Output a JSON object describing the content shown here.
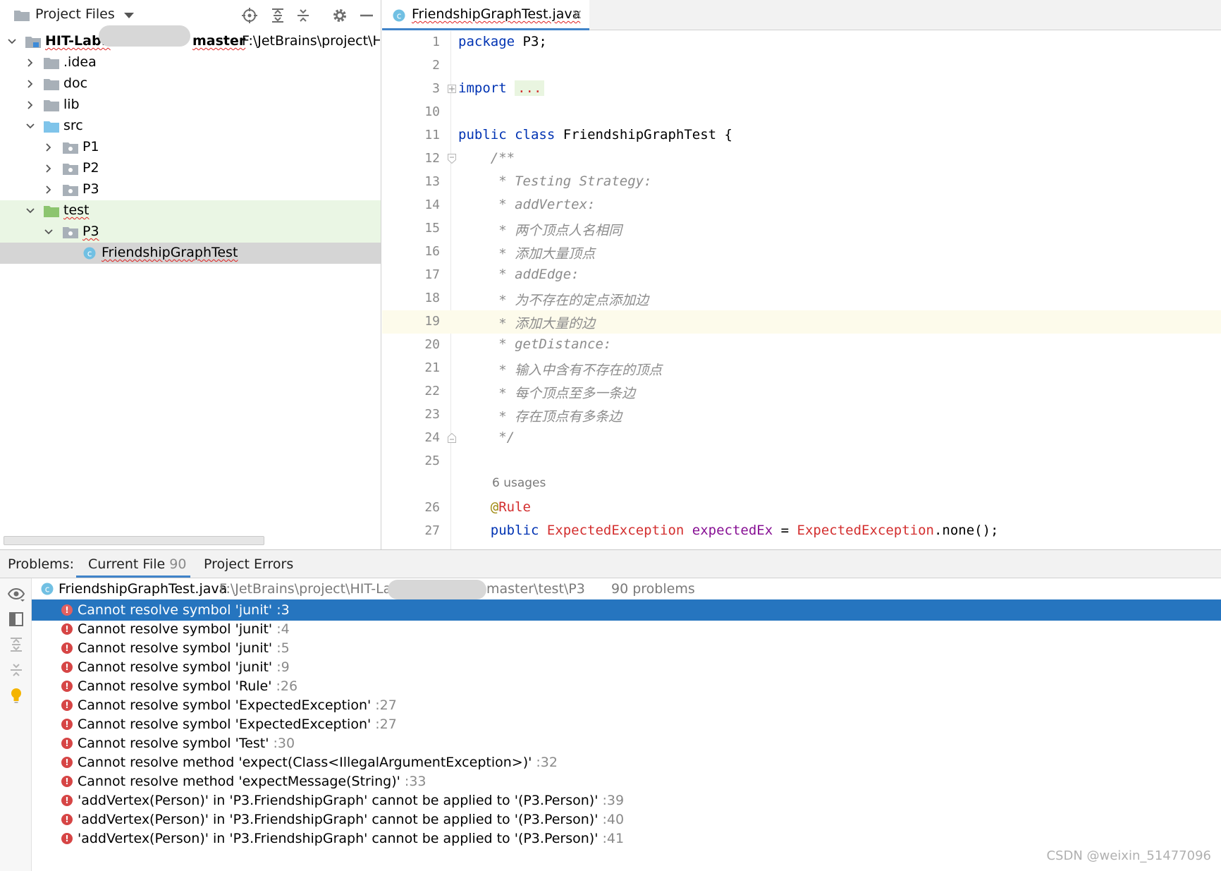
{
  "project_panel": {
    "title": "Project Files",
    "root": {
      "name_left": "HIT-Lab1",
      "name_right": "master",
      "path": "F:\\JetBrains\\project\\HIT"
    },
    "items": [
      {
        "label": "idea_placeholder"
      }
    ],
    "tree": {
      "idea": ".idea",
      "doc": "doc",
      "lib": "lib",
      "src": "src",
      "p1": "P1",
      "p2": "P2",
      "p3": "P3",
      "test": "test",
      "test_p3": "P3",
      "test_file": "FriendshipGraphTest"
    }
  },
  "editor": {
    "tab_name": "FriendshipGraphTest.java",
    "tab_close": "×",
    "lines": {
      "l1": {
        "num": "1",
        "kw": "package",
        "rest": " P3;"
      },
      "l2": {
        "num": "2"
      },
      "l3": {
        "num": "3",
        "kw": "import",
        "dots": "..."
      },
      "l10": {
        "num": "10"
      },
      "l11": {
        "num": "11",
        "kw1": "public",
        "kw2": "class",
        "name": "FriendshipGraphTest",
        "brace": " {"
      },
      "l12": {
        "num": "12",
        "text": "    /**"
      },
      "l13": {
        "num": "13",
        "text": "     * Testing Strategy:"
      },
      "l14": {
        "num": "14",
        "text": "     * addVertex:"
      },
      "l15": {
        "num": "15",
        "text": "     * 两个顶点人名相同"
      },
      "l16": {
        "num": "16",
        "text": "     * 添加大量顶点"
      },
      "l17": {
        "num": "17",
        "text": "     * addEdge:"
      },
      "l18": {
        "num": "18",
        "text": "     * 为不存在的定点添加边"
      },
      "l19": {
        "num": "19",
        "text": "     * 添加大量的边"
      },
      "l20": {
        "num": "20",
        "text": "     * getDistance:"
      },
      "l21": {
        "num": "21",
        "text": "     * 输入中含有不存在的顶点"
      },
      "l22": {
        "num": "22",
        "text": "     * 每个顶点至多一条边"
      },
      "l23": {
        "num": "23",
        "text": "     * 存在顶点有多条边"
      },
      "l24": {
        "num": "24",
        "text": "     */"
      },
      "l25": {
        "num": "25"
      },
      "usages": "6 usages",
      "l26": {
        "num": "26",
        "at": "@",
        "ann": "Rule"
      },
      "l27": {
        "num": "27",
        "kw": "public",
        "type": "ExpectedException",
        "field": "expectedEx",
        "eq": " = ",
        "type2": "ExpectedException",
        "tail": ".none();"
      }
    }
  },
  "problems": {
    "label": "Problems:",
    "tabs": [
      {
        "label": "Current File",
        "count": "90"
      },
      {
        "label": "Project Errors"
      }
    ],
    "file": {
      "name": "FriendshipGraphTest.java",
      "path_left": "F:\\JetBrains\\project\\HIT-Lab",
      "path_right": "master\\test\\P3",
      "count": "90 problems"
    },
    "items": [
      {
        "msg": "Cannot resolve symbol 'junit'",
        "line": ":3"
      },
      {
        "msg": "Cannot resolve symbol 'junit'",
        "line": ":4"
      },
      {
        "msg": "Cannot resolve symbol 'junit'",
        "line": ":5"
      },
      {
        "msg": "Cannot resolve symbol 'junit'",
        "line": ":9"
      },
      {
        "msg": "Cannot resolve symbol 'Rule'",
        "line": ":26"
      },
      {
        "msg": "Cannot resolve symbol 'ExpectedException'",
        "line": ":27"
      },
      {
        "msg": "Cannot resolve symbol 'ExpectedException'",
        "line": ":27"
      },
      {
        "msg": "Cannot resolve symbol 'Test'",
        "line": ":30"
      },
      {
        "msg": "Cannot resolve method 'expect(Class<IllegalArgumentException>)'",
        "line": ":32"
      },
      {
        "msg": "Cannot resolve method 'expectMessage(String)'",
        "line": ":33"
      },
      {
        "msg": "'addVertex(Person)' in 'P3.FriendshipGraph' cannot be applied to '(P3.Person)'",
        "line": ":39"
      },
      {
        "msg": "'addVertex(Person)' in 'P3.FriendshipGraph' cannot be applied to '(P3.Person)'",
        "line": ":40"
      },
      {
        "msg": "'addVertex(Person)' in 'P3.FriendshipGraph' cannot be applied to '(P3.Person)'",
        "line": ":41"
      }
    ],
    "error_glyph": "!"
  },
  "watermark": "CSDN @weixin_51477096",
  "colors": {
    "accent": "#4083c9",
    "selection": "#2675bf",
    "error": "#d64545",
    "test_green": "#eaf6e4"
  }
}
